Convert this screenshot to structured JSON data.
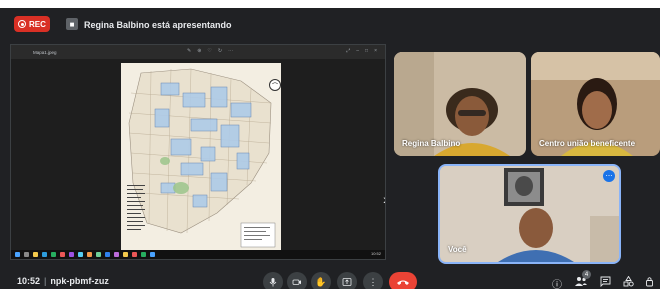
{
  "top": {
    "rec_label": "REC",
    "presenter_text": "Regina Balbino está apresentando"
  },
  "share": {
    "viewer_title": "Mapa1.jpeg",
    "clock": "10:52"
  },
  "participants": [
    {
      "name": "Regina Balbino"
    },
    {
      "name": "Centro união beneficente"
    },
    {
      "name": "Você"
    }
  ],
  "bottom": {
    "time": "10:52",
    "meeting_code": "npk-pbmf-zuz",
    "people_count": "4"
  },
  "colors": {
    "background": "#202124",
    "rec": "#d93025",
    "leave": "#ea4335",
    "accent": "#8ab4f8"
  }
}
